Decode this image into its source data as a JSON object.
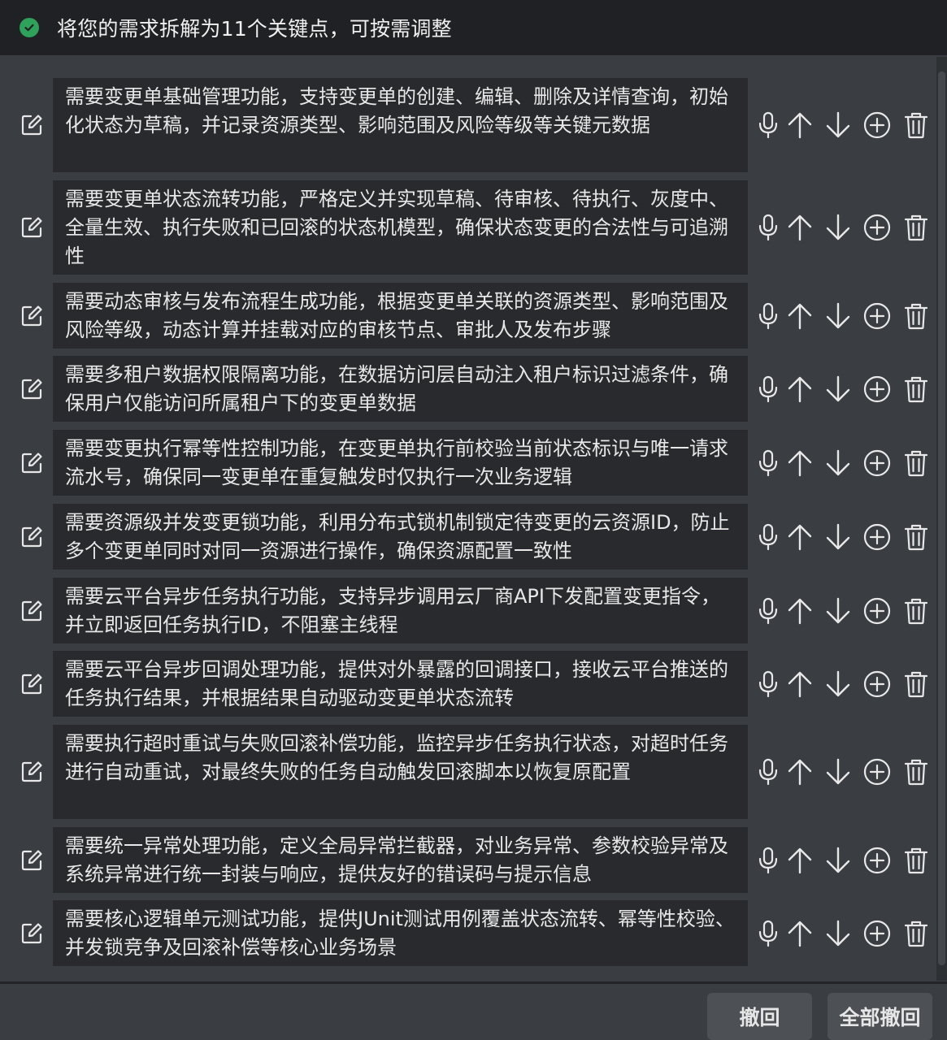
{
  "header": {
    "title": "将您的需求拆解为11个关键点，可按需调整",
    "status_color": "#2ea15a"
  },
  "items": [
    {
      "text": "需要变更单基础管理功能，支持变更单的创建、编辑、删除及详情查询，初始化状态为草稿，并记录资源类型、影响范围及风险等级等关键元数据"
    },
    {
      "text": "需要变更单状态流转功能，严格定义并实现草稿、待审核、待执行、灰度中、全量生效、执行失败和已回滚的状态机模型，确保状态变更的合法性与可追溯性"
    },
    {
      "text": "需要动态审核与发布流程生成功能，根据变更单关联的资源类型、影响范围及风险等级，动态计算并挂载对应的审核节点、审批人及发布步骤"
    },
    {
      "text": "需要多租户数据权限隔离功能，在数据访问层自动注入租户标识过滤条件，确保用户仅能访问所属租户下的变更单数据"
    },
    {
      "text": "需要变更执行幂等性控制功能，在变更单执行前校验当前状态标识与唯一请求流水号，确保同一变更单在重复触发时仅执行一次业务逻辑"
    },
    {
      "text": "需要资源级并发变更锁功能，利用分布式锁机制锁定待变更的云资源ID，防止多个变更单同时对同一资源进行操作，确保资源配置一致性"
    },
    {
      "text": "需要云平台异步任务执行功能，支持异步调用云厂商API下发配置变更指令，并立即返回任务执行ID，不阻塞主线程"
    },
    {
      "text": "需要云平台异步回调处理功能，提供对外暴露的回调接口，接收云平台推送的任务执行结果，并根据结果自动驱动变更单状态流转"
    },
    {
      "text": "需要执行超时重试与失败回滚补偿功能，监控异步任务执行状态，对超时任务进行自动重试，对最终失败的任务自动触发回滚脚本以恢复原配置"
    },
    {
      "text": "需要统一异常处理功能，定义全局异常拦截器，对业务异常、参数校验异常及系统异常进行统一封装与响应，提供友好的错误码与提示信息"
    },
    {
      "text": "需要核心逻辑单元测试功能，提供JUnit测试用例覆盖状态流转、幂等性校验、并发锁竞争及回滚补偿等核心业务场景"
    }
  ],
  "footer": {
    "undo_label": "撤回",
    "undo_all_label": "全部撤回"
  }
}
